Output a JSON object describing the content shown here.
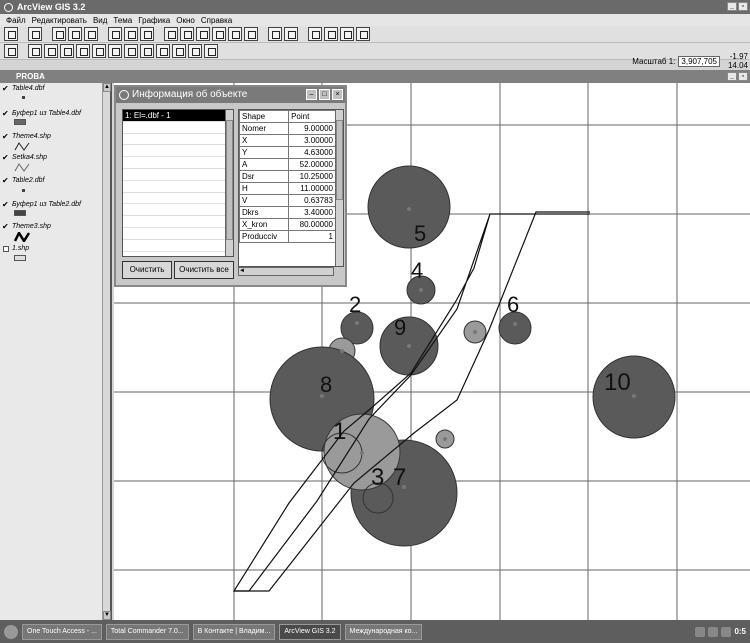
{
  "app": {
    "title": "ArcView GIS 3.2"
  },
  "menu": [
    "Файл",
    "Редактировать",
    "Вид",
    "Тема",
    "Графика",
    "Окно",
    "Справка"
  ],
  "scale": {
    "label": "Масштаб 1:",
    "value": "3,907,705"
  },
  "coords": {
    "x": "-1.97",
    "y": "14.04"
  },
  "view": {
    "title": "PROBA"
  },
  "toc": [
    {
      "name": "Table4.dbf",
      "checked": true
    },
    {
      "name": "Буфер1 из Table4.dbf",
      "checked": true
    },
    {
      "name": "Theme4.shp",
      "checked": true
    },
    {
      "name": "Setka4.shp",
      "checked": true
    },
    {
      "name": "Table2.dbf",
      "checked": true
    },
    {
      "name": "Буфер1 из Table2.dbf",
      "checked": true
    },
    {
      "name": "Theme3.shp",
      "checked": true
    },
    {
      "name": "1.shp",
      "checked": false
    }
  ],
  "info": {
    "title": "Информация об объекте",
    "selected": "1: El=.dbf - 1",
    "attributes": [
      [
        "Shape",
        "Point"
      ],
      [
        "Nomer",
        "9.00000"
      ],
      [
        "X",
        "3.00000"
      ],
      [
        "Y",
        "4.63000"
      ],
      [
        "A",
        "52.00000"
      ],
      [
        "Dsr",
        "10.25000"
      ],
      [
        "H",
        "11.00000"
      ],
      [
        "V",
        "0.63783"
      ],
      [
        "Dkrs",
        "3.40000"
      ],
      [
        "X_kron",
        "80.00000"
      ],
      [
        "Producciv",
        "1"
      ]
    ],
    "clear": "Очистить",
    "clear_all": "Очистить все"
  },
  "map_labels": [
    "5",
    "4",
    "2",
    "9",
    "6",
    "8",
    "10",
    "1",
    "3",
    "7"
  ],
  "taskbar": {
    "tasks": [
      "One Touch Access - ...",
      "Total Commander 7.0...",
      "В Контакте | Владим...",
      "ArcView GIS 3.2",
      "Международная ко..."
    ],
    "clock": "0:5"
  }
}
